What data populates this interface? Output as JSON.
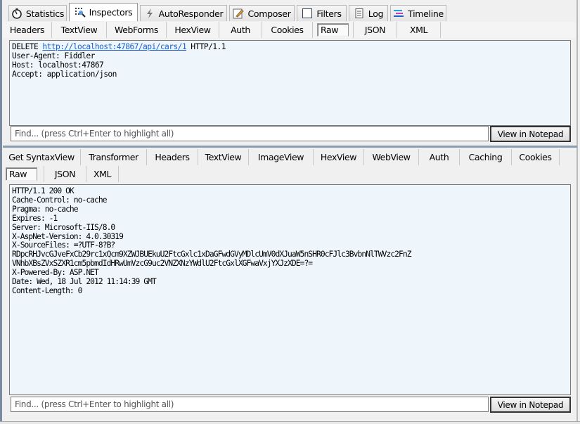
{
  "main_tabs": [
    {
      "label": "Statistics",
      "icon": "stopwatch-icon"
    },
    {
      "label": "Inspectors",
      "icon": "inspectors-icon",
      "active": true
    },
    {
      "label": "AutoResponder",
      "icon": "lightning-icon"
    },
    {
      "label": "Composer",
      "icon": "pencil-icon"
    },
    {
      "label": "Filters",
      "icon": "checkbox-icon"
    },
    {
      "label": "Log",
      "icon": "log-icon"
    },
    {
      "label": "Timeline",
      "icon": "timeline-icon"
    }
  ],
  "request": {
    "tabs": [
      "Headers",
      "TextView",
      "WebForms",
      "HexView",
      "Auth",
      "Cookies",
      "Raw",
      "JSON",
      "XML"
    ],
    "active_tab": "Raw",
    "method": "DELETE",
    "url": "http://localhost:47867/api/cars/1",
    "protocol": "HTTP/1.1",
    "lines": [
      "User-Agent: Fiddler",
      "Host: localhost:47867",
      "Accept: application/json"
    ],
    "find_placeholder": "Find... (press Ctrl+Enter to highlight all)",
    "notepad_label": "View in Notepad"
  },
  "response": {
    "tabs_row1": [
      "Get SyntaxView",
      "Transformer",
      "Headers",
      "TextView",
      "ImageView",
      "HexView",
      "WebView",
      "Auth",
      "Caching",
      "Cookies"
    ],
    "tabs_row2": [
      "Raw",
      "JSON",
      "XML"
    ],
    "active_tab": "Raw",
    "lines": [
      "HTTP/1.1 200 OK",
      "Cache-Control: no-cache",
      "Pragma: no-cache",
      "Expires: -1",
      "Server: Microsoft-IIS/8.0",
      "X-AspNet-Version: 4.0.30319",
      "X-SourceFiles: =?UTF-8?B?",
      "RDpcRHJvcGJveFxCb29rc1xQcm9XZWJBUEkuU2FtcGxlc1xDaGFwdGVyMDlcUmV0dXJuaW5nSHR0cFJlc3BvbnNlTWVzc2FnZ",
      "VNhbXBsZVxSZXR1cm5pbmdIdHRwUmVzcG9uc2VNZXNzYWdlU2FtcGxlXGFwaVxjYXJzXDE=?=",
      "X-Powered-By: ASP.NET",
      "Date: Wed, 18 Jul 2012 11:14:39 GMT",
      "Content-Length: 0"
    ],
    "find_placeholder": "Find... (press Ctrl+Enter to highlight all)",
    "notepad_label": "View in Notepad"
  }
}
